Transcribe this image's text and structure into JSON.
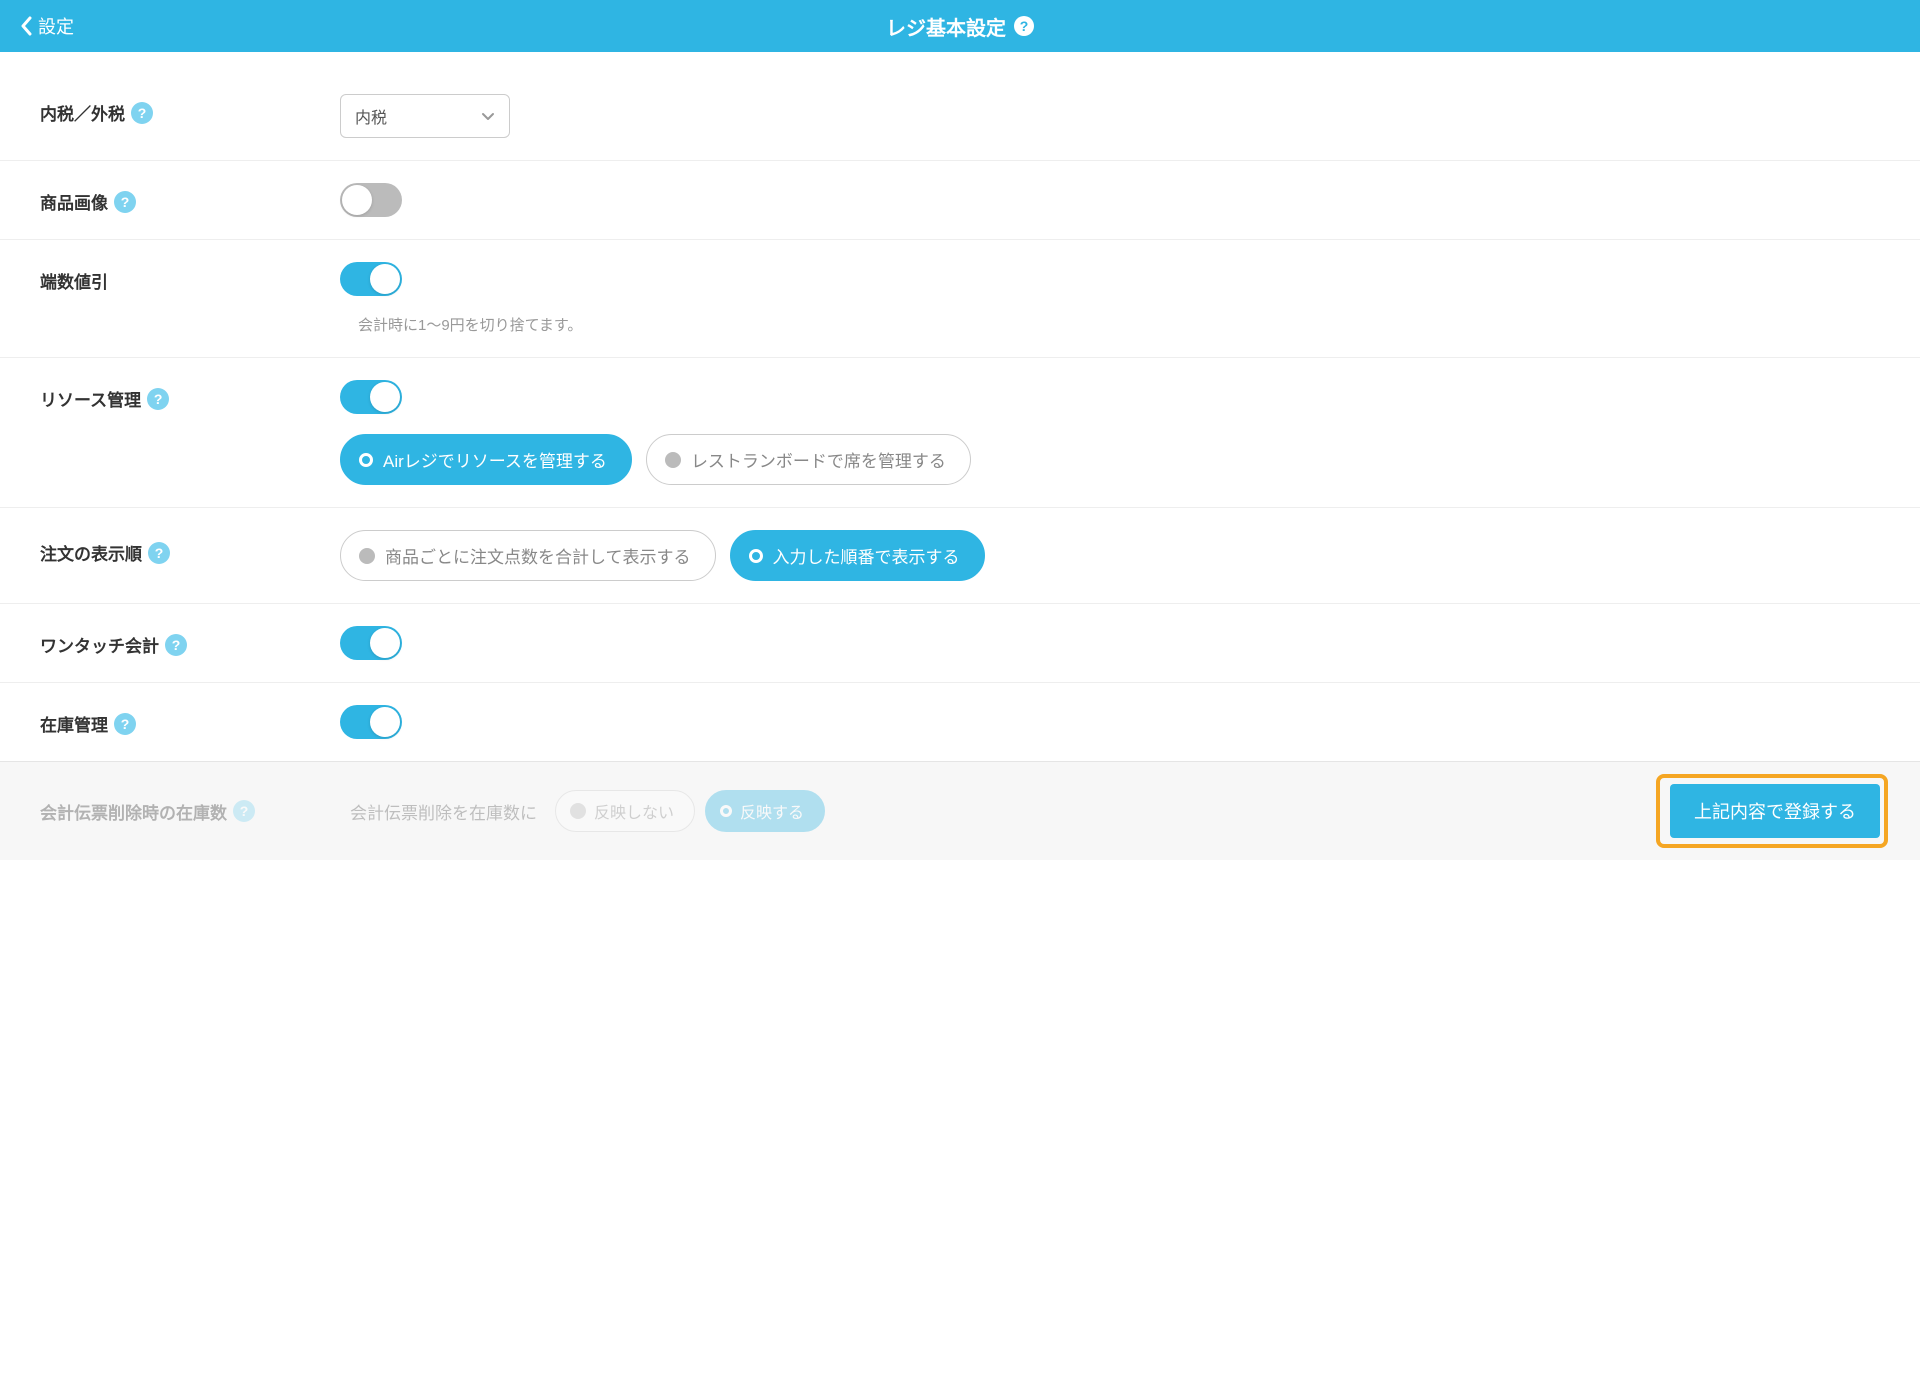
{
  "header": {
    "back_label": "設定",
    "title": "レジ基本設定"
  },
  "rows": {
    "tax": {
      "label": "内税／外税",
      "value": "内税",
      "has_help": true
    },
    "image": {
      "label": "商品画像",
      "has_help": true,
      "on": false
    },
    "rounding": {
      "label": "端数値引",
      "on": true,
      "hint": "会計時に1〜9円を切り捨てます。"
    },
    "resource": {
      "label": "リソース管理",
      "has_help": true,
      "on": true,
      "options": [
        "Airレジでリソースを管理する",
        "レストランボードで席を管理する"
      ],
      "selected": 0
    },
    "order": {
      "label": "注文の表示順",
      "has_help": true,
      "options": [
        "商品ごとに注文点数を合計して表示する",
        "入力した順番で表示する"
      ],
      "selected": 1
    },
    "onetouch": {
      "label": "ワンタッチ会計",
      "has_help": true,
      "on": true
    },
    "stock": {
      "label": "在庫管理",
      "has_help": true,
      "on": true
    }
  },
  "footer": {
    "faded_label": "会計伝票削除時の在庫数",
    "faded_text": "会計伝票削除を在庫数に",
    "option_a": "反映しない",
    "option_b": "反映する",
    "save_label": "上記内容で登録する"
  }
}
